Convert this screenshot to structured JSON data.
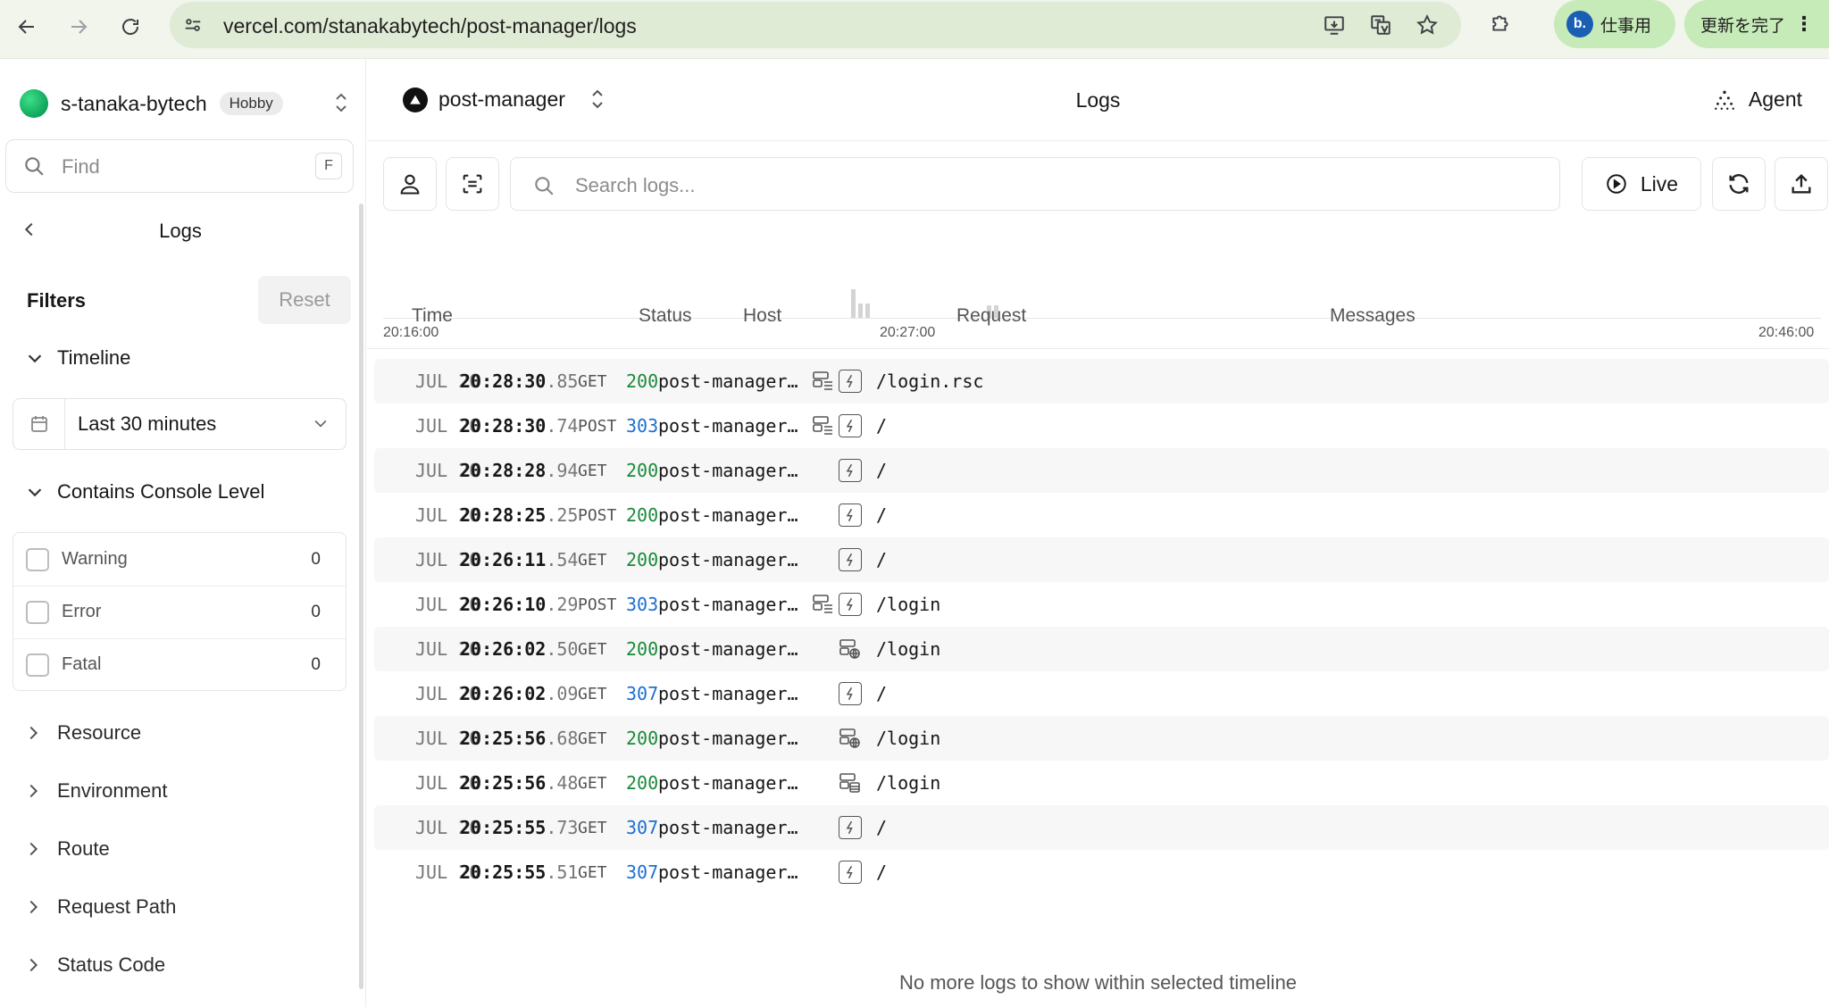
{
  "browser": {
    "url": "vercel.com/stanakabytech/post-manager/logs",
    "profile_initial": "b.",
    "profile_label": "仕事用",
    "update_label": "更新を完了"
  },
  "sidebar": {
    "team_name": "s-tanaka-bytech",
    "plan_badge": "Hobby",
    "find_placeholder": "Find",
    "find_shortcut": "F",
    "section_title": "Logs",
    "filters_label": "Filters",
    "reset_label": "Reset",
    "timeline_label": "Timeline",
    "timeline_value": "Last 30 minutes",
    "console_level_label": "Contains Console Level",
    "levels": [
      {
        "label": "Warning",
        "count": "0"
      },
      {
        "label": "Error",
        "count": "0"
      },
      {
        "label": "Fatal",
        "count": "0"
      }
    ],
    "collapsed_filters": [
      "Resource",
      "Environment",
      "Route",
      "Request Path",
      "Status Code"
    ]
  },
  "main": {
    "project_name": "post-manager",
    "page_title": "Logs",
    "agent_label": "Agent",
    "search_placeholder": "Search logs...",
    "live_label": "Live",
    "timeline_ticks": [
      "20:16:00",
      "20:27:00",
      "20:46:00"
    ],
    "columns": [
      "Time",
      "Status",
      "Host",
      "Request",
      "Messages"
    ],
    "footer_message": "No more logs to show within selected timeline"
  },
  "colors": {
    "status_ok": "#1a8a3a",
    "status_redirect": "#1c6fd1"
  },
  "logs": [
    {
      "date": "JUL 20",
      "time": "20:28:30",
      "ms": ".85",
      "method": "GET",
      "status": "200",
      "host": "post-manager…",
      "icons": [
        "middleware-icon",
        "function-icon"
      ],
      "path": "/login.rsc"
    },
    {
      "date": "JUL 20",
      "time": "20:28:30",
      "ms": ".74",
      "method": "POST",
      "status": "303",
      "host": "post-manager…",
      "icons": [
        "middleware-icon",
        "function-icon"
      ],
      "path": "/"
    },
    {
      "date": "JUL 20",
      "time": "20:28:28",
      "ms": ".94",
      "method": "GET",
      "status": "200",
      "host": "post-manager…",
      "icons": [
        "function-icon"
      ],
      "path": "/"
    },
    {
      "date": "JUL 20",
      "time": "20:28:25",
      "ms": ".25",
      "method": "POST",
      "status": "200",
      "host": "post-manager…",
      "icons": [
        "function-icon"
      ],
      "path": "/"
    },
    {
      "date": "JUL 20",
      "time": "20:26:11",
      "ms": ".54",
      "method": "GET",
      "status": "200",
      "host": "post-manager…",
      "icons": [
        "function-icon"
      ],
      "path": "/"
    },
    {
      "date": "JUL 20",
      "time": "20:26:10",
      "ms": ".29",
      "method": "POST",
      "status": "303",
      "host": "post-manager…",
      "icons": [
        "middleware-icon",
        "function-icon"
      ],
      "path": "/login"
    },
    {
      "date": "JUL 20",
      "time": "20:26:02",
      "ms": ".50",
      "method": "GET",
      "status": "200",
      "host": "post-manager…",
      "icons": [
        "edge-globe-icon"
      ],
      "path": "/login"
    },
    {
      "date": "JUL 20",
      "time": "20:26:02",
      "ms": ".09",
      "method": "GET",
      "status": "307",
      "host": "post-manager…",
      "icons": [
        "function-icon"
      ],
      "path": "/"
    },
    {
      "date": "JUL 20",
      "time": "20:25:56",
      "ms": ".68",
      "method": "GET",
      "status": "200",
      "host": "post-manager…",
      "icons": [
        "edge-globe-icon"
      ],
      "path": "/login"
    },
    {
      "date": "JUL 20",
      "time": "20:25:56",
      "ms": ".48",
      "method": "GET",
      "status": "200",
      "host": "post-manager…",
      "icons": [
        "cache-icon"
      ],
      "path": "/login"
    },
    {
      "date": "JUL 20",
      "time": "20:25:55",
      "ms": ".73",
      "method": "GET",
      "status": "307",
      "host": "post-manager…",
      "icons": [
        "function-icon"
      ],
      "path": "/"
    },
    {
      "date": "JUL 20",
      "time": "20:25:55",
      "ms": ".51",
      "method": "GET",
      "status": "307",
      "host": "post-manager…",
      "icons": [
        "function-icon"
      ],
      "path": "/"
    }
  ]
}
